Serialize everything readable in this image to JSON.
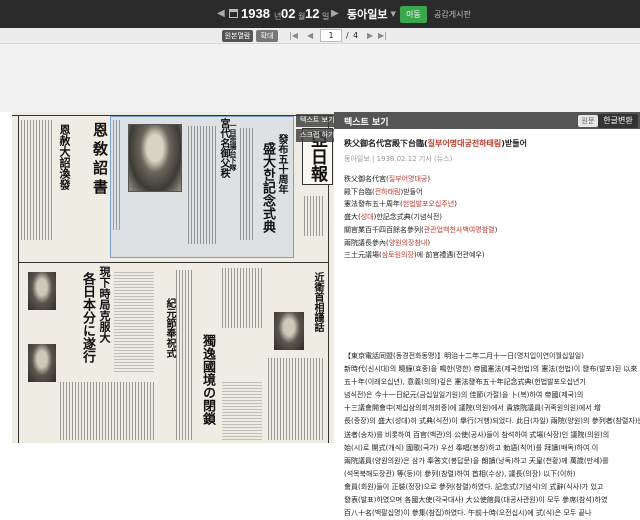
{
  "header": {
    "prev_arrow": "◀",
    "next_arrow": "▶",
    "calendar_icon": "calendar-icon",
    "year": "1938",
    "year_unit": "년",
    "month": "02",
    "month_unit": "월",
    "day": "12",
    "day_unit": "일",
    "newspaper": "동아일보",
    "move_button": "이동",
    "board_link": "공감게시판"
  },
  "toolbar": {
    "original_view": "원본열람",
    "zoom": "확대",
    "first": "|◀",
    "prev": "◀",
    "page_current": "1",
    "page_sep": "/",
    "page_total": "4",
    "next": "▶",
    "last": "▶|"
  },
  "paper_overlay": {
    "text_view_tab": "텍스트 보기",
    "scrap_tab": "스크랩 하기"
  },
  "newspaper_image": {
    "masthead": "亞日報",
    "headline_right": "宮代名御父秩",
    "headline_right2": "一目悲揚台下隊",
    "big_heading": "盛大한記念式典",
    "heading_2": "發布五十周年",
    "left_heading_1": "恩敎詔書",
    "left_heading_2": "恩赦大詔渙發",
    "left_heading_3": "各日本分に遂行",
    "left_heading_4": "現下時局克服大",
    "center_heading": "獨逸國境の閉鎖",
    "center_heading_2": "紀元節奉祝式",
    "bottom_heading": "近衛首相謹話"
  },
  "panel": {
    "title": "텍스트 보기",
    "tab_original": "원문",
    "tab_korean": "한글변환",
    "article_title_a": "秩父御名代宮殿下台臨(",
    "article_title_b": "질부어명대궁전하태림",
    "article_title_c": ")받들어",
    "meta": "동아일보 | 1938.02.12 기사 (뉴스)",
    "lines": [
      {
        "a": "秩父御名代宮(",
        "b": "질부어명대궁",
        "c": ")"
      },
      {
        "a": "殿下台臨(",
        "b": "전하태림",
        "c": ")받들어"
      },
      {
        "a": "憲法發布五十周年(",
        "b": "헌법발포오십주년",
        "c": ")"
      },
      {
        "a": "盛大(",
        "b": "성대",
        "c": ")한記念式典(기념식전)"
      },
      {
        "a": "關官業百千四百餘名參列(",
        "b": "관관업백천사백여명참렬",
        "c": ")"
      },
      {
        "a": "兩院議長參內(",
        "b": "양원의장참내",
        "c": ")"
      },
      {
        "a": "三土元議場(",
        "b": "삼토원의장",
        "c": ")에 前官禮遇(전관예우)"
      }
    ],
    "paragraph": [
      "【東京電話同盟(동경전화동맹)】明治十二年二月十一日(명치입이연이월십일일)",
      "新時代(신시대)의 曉鐘(효종)을 鳴한(명한) 帝國憲法(제국헌법)의 憲法(헌법)이 發布(발포)된 以來",
      "五十年(이래오십년), 意義(의의)깊은 憲法發布五十年記念式典(헌법발포오십년기",
      "념식전)은 今十一日紀元(금십일일기원)의 佳節(가절)을 卜(복)하여 帝國(제국)의",
      "十三議會開會中(제십삼의회개회중)에 議院(의원)에서 貴族院議員(귀족원의원)에서 增",
      "長(증장)의 盛大(성대)히 式典(식전)이 擧行(거행)되었다. 此日(차일) 兩院(양원)의 參列者(참렬자)는",
      "送者(송자)를 비롯하여 百官(백관)의 公使(공사)들이 참석하여 式場(식장)인 議院(의원)의",
      "始(시)로 開式(개식) 國歌(국가) 우선 奉唱(봉창)하고 勅語(칙어)를 拜讀(배독)하여 이",
      "兩院議員(양원의원)은 삼가 奉答文(봉답문)을 朗讀(낭독)하고 天皇(천황)께 萬歲(만세)를",
      "(석목북해도장관) 等(등)이 參列(참렬)하여 首相(수상), 議長(의장) 以下(이하)",
      "會員(회원)들이 正裝(정장)으로 參列(참렬)하였다. 記念式(기념식)의 式辭(식사)가 있고",
      "發表(발표)하였으며 各國大使(각국대사) 大公使館員(대공사관원)이 모두 參席(참석)하였",
      "百八十名(백팔십명)이 參集(참집)하였다. 午前十時(오전십시)에 式(식)은 모두 끝나"
    ]
  }
}
